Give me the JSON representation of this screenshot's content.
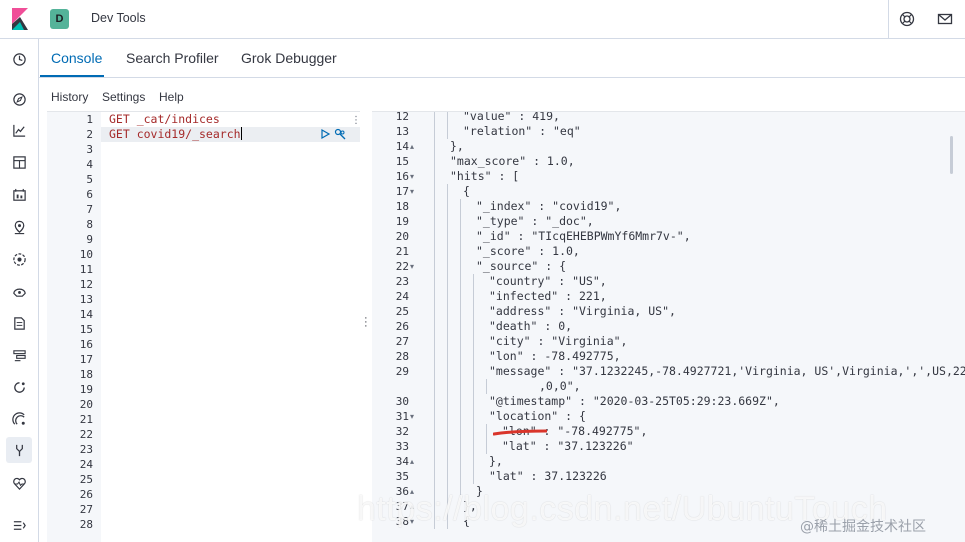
{
  "header": {
    "space_initial": "D",
    "app_title": "Dev Tools",
    "accent": "#006bb4"
  },
  "nav": {
    "icons": [
      "clock-icon",
      "compass-icon",
      "visualize-icon",
      "dashboard-icon",
      "canvas-icon",
      "maps-icon",
      "ml-icon",
      "metrics-icon",
      "logs-icon",
      "apm-icon",
      "uptime-icon",
      "siem-icon",
      "devtools-icon",
      "monitoring-icon",
      "collapse-icon"
    ]
  },
  "tabs": [
    {
      "label": "Console"
    },
    {
      "label": "Search Profiler"
    },
    {
      "label": "Grok Debugger"
    }
  ],
  "menu": {
    "history": "History",
    "settings": "Settings",
    "help": "Help"
  },
  "editor": {
    "line_numbers": [
      "1",
      "2",
      "3",
      "4",
      "5",
      "6",
      "7",
      "8",
      "9",
      "10",
      "11",
      "12",
      "13",
      "14",
      "15",
      "16",
      "17",
      "18",
      "19",
      "20",
      "21",
      "22",
      "23",
      "24",
      "25",
      "26",
      "27",
      "28"
    ],
    "lines": [
      "GET _cat/indices",
      "GET covid19/_search"
    ]
  },
  "output": {
    "lines": [
      {
        "n": "12",
        "fold": "",
        "text": "\"value\" : 419,"
      },
      {
        "n": "13",
        "fold": "",
        "text": "\"relation\" : \"eq\""
      },
      {
        "n": "14",
        "fold": "▴",
        "text": "},"
      },
      {
        "n": "15",
        "fold": "",
        "text": "\"max_score\" : 1.0,"
      },
      {
        "n": "16",
        "fold": "▾",
        "text": "\"hits\" : ["
      },
      {
        "n": "17",
        "fold": "▾",
        "text": "{"
      },
      {
        "n": "18",
        "fold": "",
        "text": "\"_index\" : \"covid19\","
      },
      {
        "n": "19",
        "fold": "",
        "text": "\"_type\" : \"_doc\","
      },
      {
        "n": "20",
        "fold": "",
        "text": "\"_id\" : \"TIcqEHEBPWmYf6Mmr7v-\","
      },
      {
        "n": "21",
        "fold": "",
        "text": "\"_score\" : 1.0,"
      },
      {
        "n": "22",
        "fold": "▾",
        "text": "\"_source\" : {"
      },
      {
        "n": "23",
        "fold": "",
        "text": "\"country\" : \"US\","
      },
      {
        "n": "24",
        "fold": "",
        "text": "\"infected\" : 221,"
      },
      {
        "n": "25",
        "fold": "",
        "text": "\"address\" : \"Virginia, US\","
      },
      {
        "n": "26",
        "fold": "",
        "text": "\"death\" : 0,"
      },
      {
        "n": "27",
        "fold": "",
        "text": "\"city\" : \"Virginia\","
      },
      {
        "n": "28",
        "fold": "",
        "text": "\"lon\" : -78.492775,"
      },
      {
        "n": "29",
        "fold": "",
        "text": "\"message\" : \"37.1232245,-78.4927721,'Virginia, US',Virginia,',',US,221"
      },
      {
        "n": "",
        "fold": "",
        "text": ",0,0\","
      },
      {
        "n": "30",
        "fold": "",
        "text": "\"@timestamp\" : \"2020-03-25T05:29:23.669Z\","
      },
      {
        "n": "31",
        "fold": "▾",
        "text": "\"location\" : {"
      },
      {
        "n": "32",
        "fold": "",
        "text": "\"lon\" : \"-78.492775\","
      },
      {
        "n": "33",
        "fold": "",
        "text": "\"lat\" : \"37.123226\""
      },
      {
        "n": "34",
        "fold": "▴",
        "text": "},"
      },
      {
        "n": "35",
        "fold": "",
        "text": "\"lat\" : 37.123226"
      },
      {
        "n": "36",
        "fold": "▴",
        "text": "}"
      },
      {
        "n": "37",
        "fold": "▴",
        "text": "},"
      },
      {
        "n": "38",
        "fold": "▾",
        "text": "{"
      }
    ]
  },
  "watermark": {
    "text": "https://blog.csdn.net/UbuntuTouch",
    "source": "@稀土掘金技术社区"
  }
}
